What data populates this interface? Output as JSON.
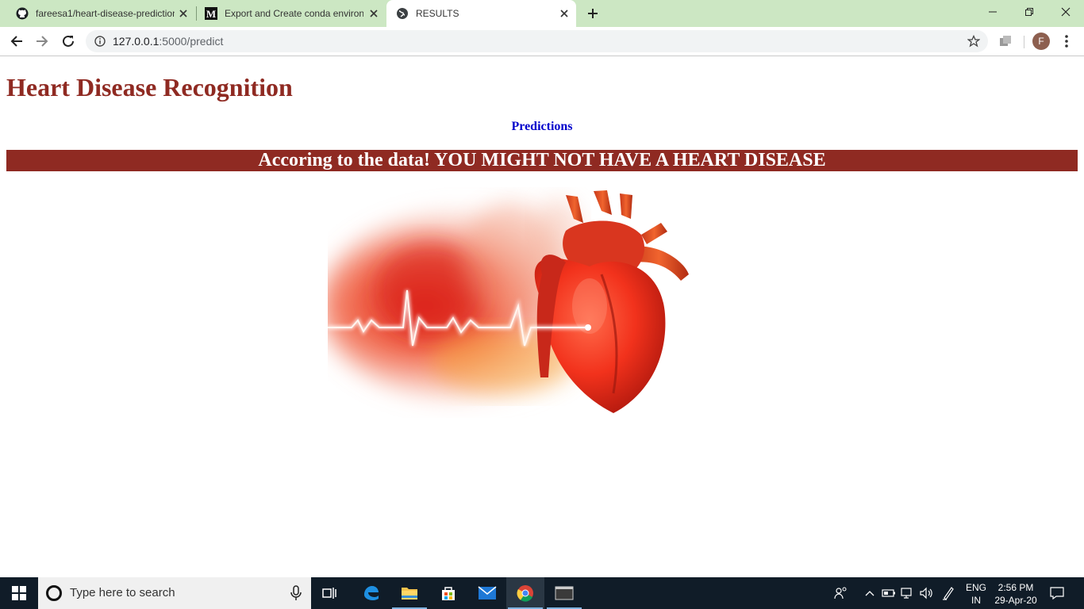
{
  "browser": {
    "tabs": [
      {
        "title": "fareesa1/heart-disease-prediction",
        "favicon": "github-icon"
      },
      {
        "title": "Export and Create conda environ",
        "favicon": "medium-icon"
      },
      {
        "title": "RESULTS",
        "favicon": "globe-icon"
      }
    ],
    "address": {
      "host": "127.0.0.1",
      "path": ":5000/predict"
    },
    "profile_initial": "F"
  },
  "page": {
    "title": "Heart Disease Recognition",
    "section_heading": "Predictions",
    "result_message": "Accoring to the data! YOU MIGHT NOT HAVE A HEART DISEASE",
    "image": "heart-ecg-illustration"
  },
  "taskbar": {
    "search_placeholder": "Type here to search",
    "language": {
      "line1": "ENG",
      "line2": "IN"
    },
    "clock": {
      "time": "2:56 PM",
      "date": "29-Apr-20"
    }
  },
  "colors": {
    "accent": "#8f2a22",
    "heading_blue": "#0000cc",
    "tabstrip": "#cce7c3",
    "taskbar": "#101c28"
  }
}
